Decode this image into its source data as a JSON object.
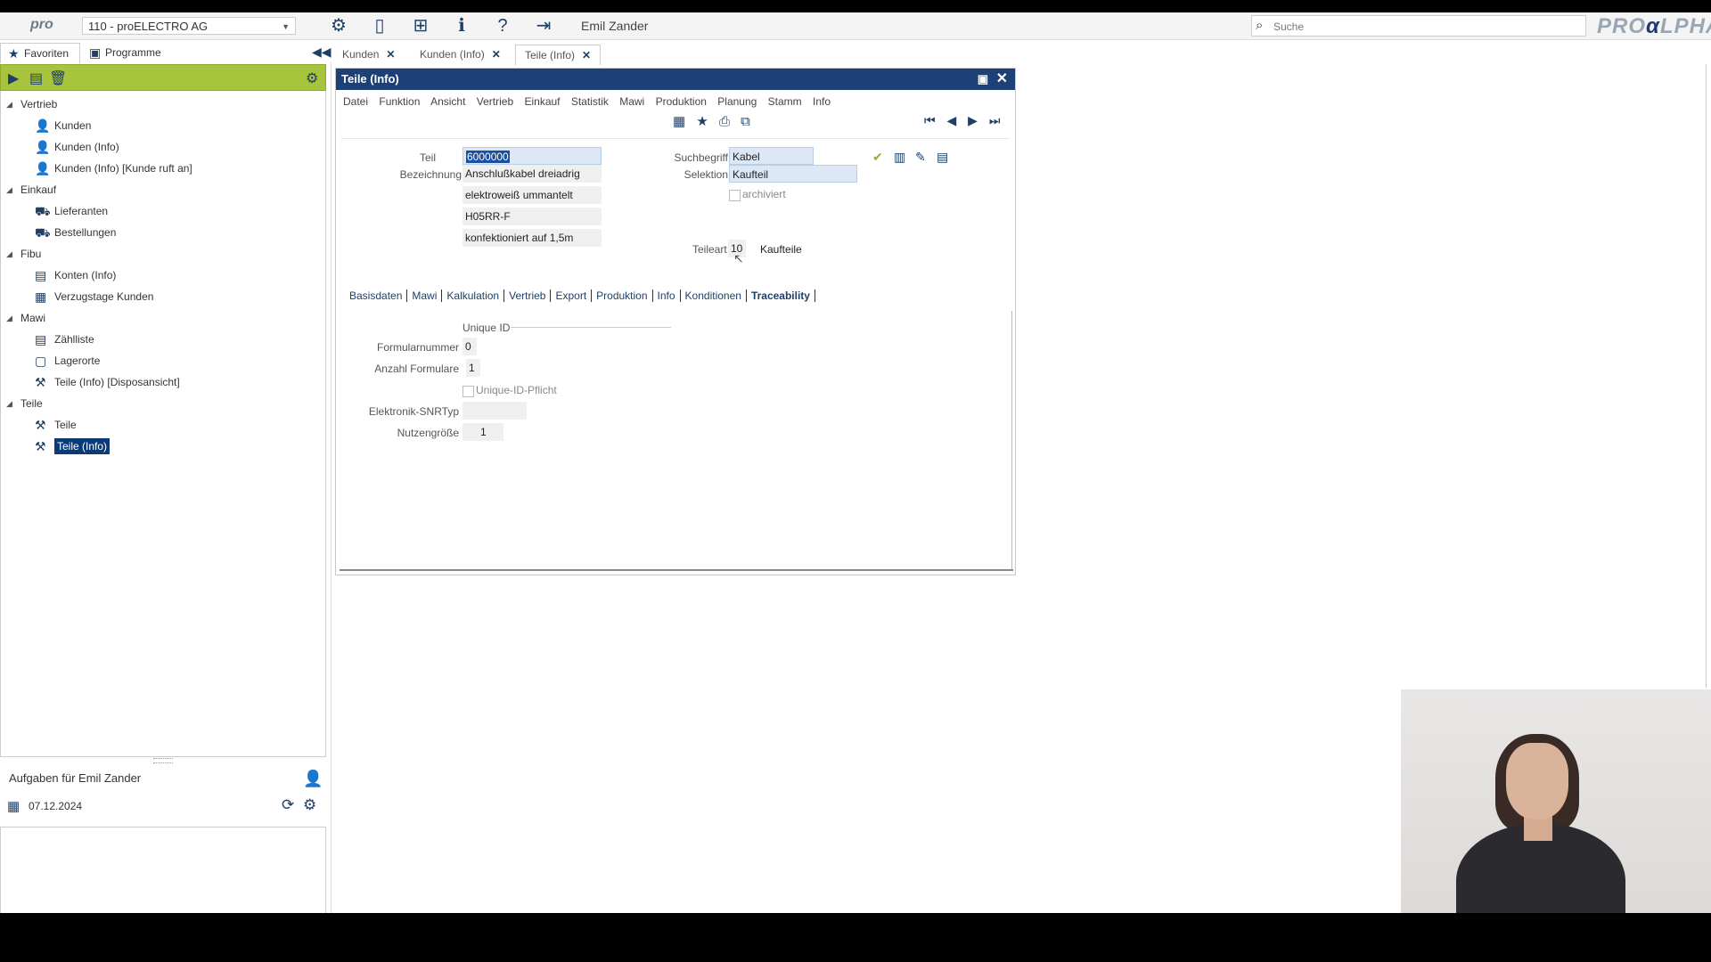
{
  "topbar": {
    "logo": "pro",
    "company": "110 - proELECTRO AG",
    "user": "Emil Zander",
    "search_placeholder": "Suche",
    "brand": "PRO",
    "brand2": "α",
    "brand3": "LPHA"
  },
  "left": {
    "tabs": [
      "Favoriten",
      "Programme"
    ],
    "tree": [
      {
        "type": "group",
        "label": "Vertrieb"
      },
      {
        "type": "item",
        "label": "Kunden"
      },
      {
        "type": "item",
        "label": "Kunden (Info)"
      },
      {
        "type": "item",
        "label": "Kunden (Info) [Kunde ruft an]"
      },
      {
        "type": "group",
        "label": "Einkauf"
      },
      {
        "type": "item",
        "label": "Lieferanten"
      },
      {
        "type": "item",
        "label": "Bestellungen"
      },
      {
        "type": "group",
        "label": "Fibu"
      },
      {
        "type": "item",
        "label": "Konten (Info)"
      },
      {
        "type": "item",
        "label": "Verzugstage Kunden"
      },
      {
        "type": "group",
        "label": "Mawi"
      },
      {
        "type": "item",
        "label": "Zählliste"
      },
      {
        "type": "item",
        "label": "Lagerorte"
      },
      {
        "type": "item",
        "label": "Teile (Info) [Disposansicht]"
      },
      {
        "type": "group",
        "label": "Teile"
      },
      {
        "type": "item",
        "label": "Teile"
      },
      {
        "type": "item",
        "label": "Teile (Info)",
        "selected": true
      }
    ],
    "tasks_title": "Aufgaben für Emil Zander",
    "tasks_date": "07.12.2024"
  },
  "doctabs": [
    "Kunden",
    "Kunden (Info)",
    "Teile (Info)"
  ],
  "window": {
    "title": "Teile (Info)",
    "menu": [
      "Datei",
      "Funktion",
      "Ansicht",
      "Vertrieb",
      "Einkauf",
      "Statistik",
      "Mawi",
      "Produktion",
      "Planung",
      "Stamm",
      "Info"
    ],
    "teil_label": "Teil",
    "teil_value": "6000000",
    "bezeichnung_label": "Bezeichnung",
    "bezeichnung_lines": [
      "Anschlußkabel dreiadrig",
      "elektroweiß ummantelt",
      "H05RR-F",
      "konfektioniert auf 1,5m"
    ],
    "suchbegriff_label": "Suchbegriff",
    "suchbegriff_value": "Kabel",
    "selektion_label": "Selektion",
    "selektion_value": "Kaufteil",
    "archiviert_label": "archiviert",
    "teileart_label": "Teileart",
    "teileart_code": "10",
    "teileart_text": "Kaufteile",
    "tabs": [
      "Basisdaten",
      "Mawi",
      "Kalkulation",
      "Vertrieb",
      "Export",
      "Produktion",
      "Info",
      "Konditionen",
      "Traceability"
    ],
    "unique_id_header": "Unique ID",
    "formularnummer_label": "Formularnummer",
    "formularnummer_value": "0",
    "anzahl_label": "Anzahl Formulare",
    "anzahl_value": "1",
    "uid_pflicht_label": "Unique-ID-Pflicht",
    "snr_label": "Elektronik-SNRTyp",
    "snr_value": "",
    "nutzen_label": "Nutzengröße",
    "nutzen_value": "1"
  },
  "colors": {
    "accent_blue": "#1d4077",
    "green_bar": "#a8c43c"
  }
}
